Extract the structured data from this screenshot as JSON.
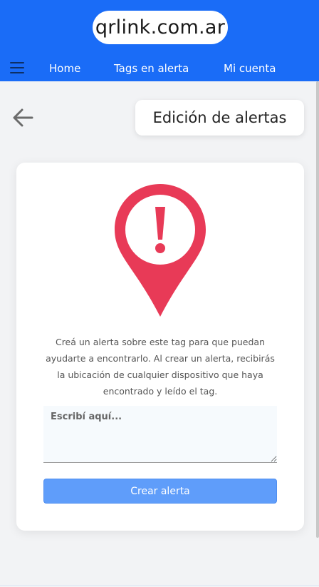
{
  "header": {
    "logo_text": "qrlink.com.ar",
    "menu_icon": "hamburger-menu-icon",
    "nav": [
      {
        "label": "Home"
      },
      {
        "label": "Tags en alerta"
      },
      {
        "label": "Mi cuenta"
      }
    ]
  },
  "page": {
    "back_icon": "arrow-left-icon",
    "title": "Edición de alertas"
  },
  "alert_card": {
    "icon": "map-pin-exclamation-icon",
    "description": "Creá un alerta sobre este tag para que puedan ayudarte a encontrarlo. Al crear un alerta, recibirás la ubicación de cualquier dispositivo que haya encontrado y leído el tag.",
    "textarea_value": "",
    "textarea_placeholder": "Escribí aquí...",
    "button_label": "Crear alerta"
  },
  "colors": {
    "header_bg": "#1a6cf7",
    "pin_red": "#e83a57",
    "button_bg": "#5f9dfa"
  }
}
